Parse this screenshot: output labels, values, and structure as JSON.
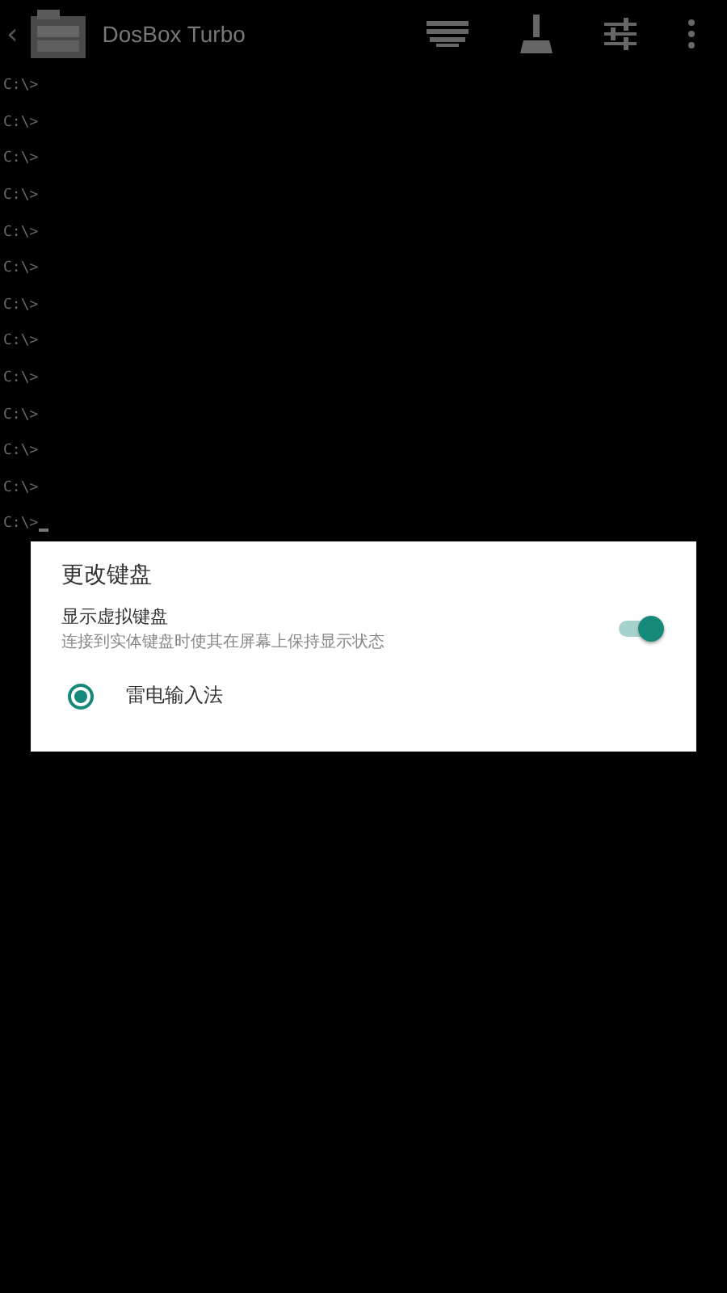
{
  "app_bar": {
    "back": "‹",
    "title": "DosBox Turbo"
  },
  "console": {
    "lines": [
      "C:\\>",
      "C:\\>",
      "C:\\>",
      "C:\\>",
      "C:\\>",
      "C:\\>",
      "C:\\>",
      "C:\\>",
      "C:\\>",
      "C:\\>",
      "C:\\>",
      "C:\\>",
      "C:\\>"
    ],
    "cursor": true
  },
  "dialog": {
    "title": "更改键盘",
    "toggle": {
      "label": "显示虚拟键盘",
      "description": "连接到实体键盘时使其在屏幕上保持显示状态",
      "on": true
    },
    "options": [
      {
        "label": "雷电输入法",
        "selected": true
      }
    ]
  }
}
